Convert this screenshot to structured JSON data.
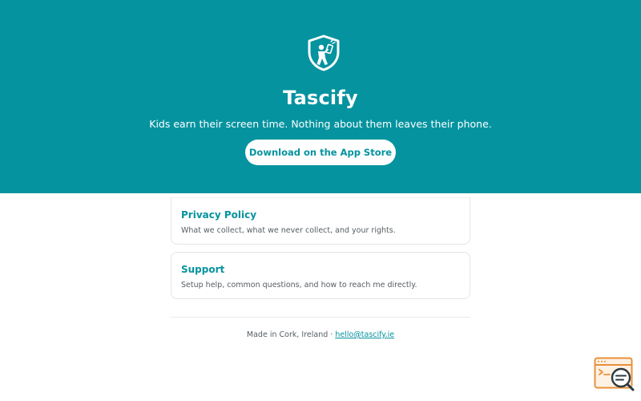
{
  "hero": {
    "logo_icon": "shield-kid-phone-icon",
    "title": "Tascify",
    "tagline": "Kids earn their screen time. Nothing about them leaves their phone.",
    "cta_label": "Download on the App Store"
  },
  "cards": [
    {
      "title": "Privacy Policy",
      "description": "What we collect, what we never collect, and your rights."
    },
    {
      "title": "Support",
      "description": "Setup help, common questions, and how to reach me directly."
    }
  ],
  "footer": {
    "text": "Made in Cork, Ireland · ",
    "email": "hello@tascify.ie"
  },
  "corner_widget_icon": "window-search-icon",
  "colors": {
    "brand": "#05939f",
    "text_muted": "#555d62",
    "widget": "#e8913a"
  }
}
